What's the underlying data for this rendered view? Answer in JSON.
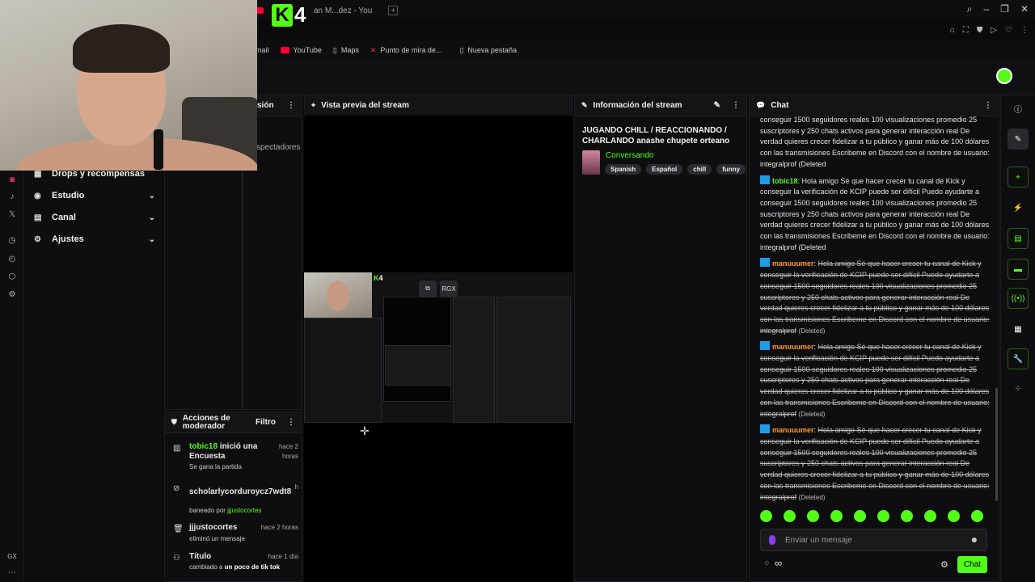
{
  "browser": {
    "tab_title": "an M...dez - You",
    "bookmarks": [
      {
        "label": "mail",
        "color": "#888888"
      },
      {
        "label": "YouTube",
        "color": "#ff0033"
      },
      {
        "label": "Maps",
        "color": "#888888"
      },
      {
        "label": "Punto de mira de...",
        "color": "#e04040"
      },
      {
        "label": "Nueva pestaña",
        "color": "#888888"
      }
    ]
  },
  "overlay": {
    "logo_k": "K",
    "logo_num": "4"
  },
  "sidebar": {
    "items": [
      {
        "label": "Drops y recompensas",
        "icon": "gift-icon",
        "glyph": "▦",
        "chevron": ""
      },
      {
        "label": "Estudio",
        "icon": "studio-icon",
        "glyph": "◉",
        "chevron": "⌄"
      },
      {
        "label": "Canal",
        "icon": "channel-icon",
        "glyph": "▤",
        "chevron": "⌄"
      },
      {
        "label": "Ajustes",
        "icon": "settings-icon",
        "glyph": "⚙",
        "chevron": "⌄"
      }
    ],
    "rail_label": "GX"
  },
  "panels": {
    "session_title_fragment": "sión",
    "spectators_fragment": "spectadores",
    "preview_title": "Vista previa del stream",
    "info_title": "Información del stream",
    "chat_title": "Chat",
    "mod_title": "Acciones de moderador",
    "mod_filter": "Filtro"
  },
  "preview": {
    "popout_label": "⧉",
    "rgx_label": "RGX"
  },
  "stream_info": {
    "title": "JUGANDO CHILL / REACCIONANDO / CHARLANDO anashe chupete orteano",
    "category": "Conversando",
    "tags": [
      "Spanish",
      "Español",
      "chill",
      "funny"
    ]
  },
  "chat": {
    "messages": [
      {
        "user": "",
        "deleted": false,
        "text": "conseguir 1500 seguidores reales 100 visualizaciones promedio 25 suscriptores y 250 chats activos para generar interacción real De verdad quieres crecer fidelizar a tu público y ganar más de 100 dólares con las transmisiones Escribeme en Discord con el nombre de usuario: integralprof (Deleted",
        "note": ""
      },
      {
        "user": "tobic18",
        "user_color": "#53fc18",
        "deleted": false,
        "text": "Hola amigo Sé que hacer crecer tu canal de Kick y conseguir la verificación de KCIP puede ser difícil Puedo ayudarte a conseguir 1500 seguidores reales 100 visualizaciones promedio 25 suscriptores y 250 chats activos para generar interacción real De verdad quieres crecer fidelizar a tu público y ganar más de 100 dólares con las transmisiones Escribeme en Discord con el nombre de usuario: integralprof (Deleted",
        "note": ""
      },
      {
        "user": "manuuumer",
        "user_color": "#ff9a2e",
        "deleted": true,
        "text": "Hola amigo Sé que hacer crecer tu canal de Kick y conseguir la verificación de KCIP puede ser difícil Puedo ayudarte a conseguir 1500 seguidores reales 100 visualizaciones promedio 25 suscriptores y 250 chats activos para generar interacción real De verdad quieres crecer fidelizar a tu público y ganar más de 100 dólares con las transmisiones Escribeme en Discord con el nombre de usuario: integralprof",
        "note": "(Deleted)"
      },
      {
        "user": "manuuumer",
        "user_color": "#ff9a2e",
        "deleted": true,
        "text": "Hola amigo Sé que hacer crecer tu canal de Kick y conseguir la verificación de KCIP puede ser difícil Puedo ayudarte a conseguir 1500 seguidores reales 100 visualizaciones promedio 25 suscriptores y 250 chats activos para generar interacción real De verdad quieres crecer fidelizar a tu público y ganar más de 100 dólares con las transmisiones Escribeme en Discord con el nombre de usuario: integralprof",
        "note": "(Deleted)"
      },
      {
        "user": "manuuumer",
        "user_color": "#ff9a2e",
        "deleted": true,
        "text": "Hola amigo Sé que hacer crecer tu canal de Kick y conseguir la verificación de KCIP puede ser difícil Puedo ayudarte a conseguir 1500 seguidores reales 100 visualizaciones promedio 25 suscriptores y 250 chats activos para generar interacción real De verdad quieres crecer fidelizar a tu público y ganar más de 100 dólares con las transmisiones Escribeme en Discord con el nombre de usuario: integralprof",
        "note": "(Deleted)"
      }
    ],
    "input_placeholder": "Enviar un mensaje",
    "send_label": "Chat",
    "infinity_label": "∞",
    "emote_count": 10
  },
  "mod_actions": [
    {
      "icon": "chart-icon",
      "glyph": "▥",
      "title": "tobic18 inició una Encuesta",
      "title_user": "tobic18",
      "title_rest": " inició una Encuesta",
      "time": "hace 2 horas",
      "sub": "Se gana la partida",
      "sub_user": ""
    },
    {
      "icon": "ban-icon",
      "glyph": "⊘",
      "title": "scholarlycorduroycz7wdt8",
      "title_user": "",
      "title_rest": "scholarlycorduroycz7wdt8",
      "time": "h",
      "sub": "baneado por ",
      "sub_user": "jjjustocortes"
    },
    {
      "icon": "trash-icon",
      "glyph": "🗑",
      "title": "jjjustocortes",
      "title_user": "",
      "title_rest": "jjjustocortes",
      "time": "hace 2 horas",
      "sub": "eliminó un mensaje",
      "sub_user": ""
    },
    {
      "icon": "title-icon",
      "glyph": "⚇",
      "title": "Título",
      "title_user": "",
      "title_rest": "Título",
      "time": "hace 1 día",
      "sub": "cambiado a ",
      "sub_bold": "un poco de tik tok",
      "sub_user": ""
    }
  ]
}
